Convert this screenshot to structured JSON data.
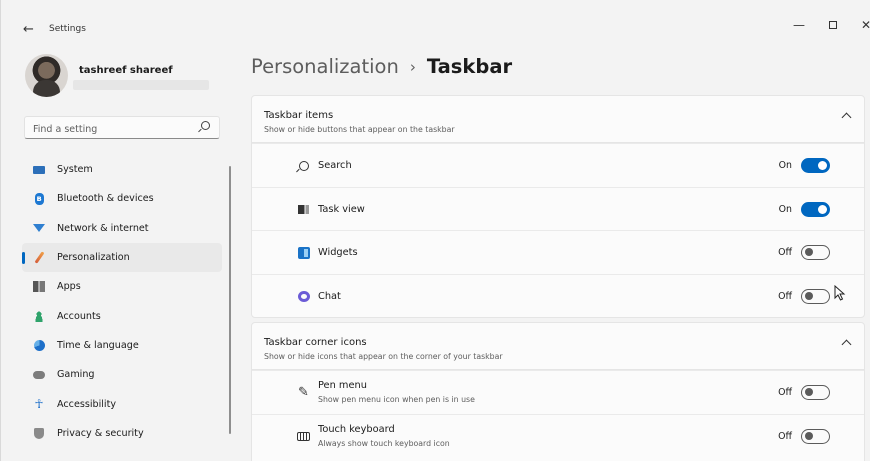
{
  "window": {
    "app_title": "Settings",
    "back_icon": "arrow-left-icon",
    "minimize_glyph": "—",
    "close_glyph": "✕"
  },
  "user": {
    "name": "tashreef shareef"
  },
  "search": {
    "placeholder": "Find a setting",
    "icon": "search-icon"
  },
  "sidebar": {
    "items": [
      {
        "label": "System",
        "icon": "monitor-icon"
      },
      {
        "label": "Bluetooth & devices",
        "icon": "bluetooth-icon"
      },
      {
        "label": "Network & internet",
        "icon": "wifi-icon"
      },
      {
        "label": "Personalization",
        "icon": "brush-icon",
        "active": true
      },
      {
        "label": "Apps",
        "icon": "apps-icon"
      },
      {
        "label": "Accounts",
        "icon": "person-icon"
      },
      {
        "label": "Time & language",
        "icon": "globe-clock-icon"
      },
      {
        "label": "Gaming",
        "icon": "gamepad-icon"
      },
      {
        "label": "Accessibility",
        "icon": "accessibility-icon"
      },
      {
        "label": "Privacy & security",
        "icon": "shield-icon"
      }
    ],
    "accent_color": "#0067c0"
  },
  "breadcrumb": {
    "parent": "Personalization",
    "separator": "›",
    "current": "Taskbar"
  },
  "sections": {
    "taskbar_items": {
      "title": "Taskbar items",
      "subtitle": "Show or hide buttons that appear on the taskbar",
      "rows": [
        {
          "label": "Search",
          "state": "On",
          "on": true,
          "icon": "search-icon"
        },
        {
          "label": "Task view",
          "state": "On",
          "on": true,
          "icon": "task-view-icon"
        },
        {
          "label": "Widgets",
          "state": "Off",
          "on": false,
          "icon": "widgets-icon"
        },
        {
          "label": "Chat",
          "state": "Off",
          "on": false,
          "icon": "chat-icon"
        }
      ]
    },
    "corner_icons": {
      "title": "Taskbar corner icons",
      "subtitle": "Show or hide icons that appear on the corner of your taskbar",
      "rows": [
        {
          "label": "Pen menu",
          "description": "Show pen menu icon when pen is in use",
          "state": "Off",
          "on": false,
          "icon": "pen-icon"
        },
        {
          "label": "Touch keyboard",
          "description": "Always show touch keyboard icon",
          "state": "Off",
          "on": false,
          "icon": "keyboard-icon"
        }
      ]
    }
  },
  "colors": {
    "toggle_on": "#0067c0",
    "background": "#f3f3f3",
    "card": "#fbfbfb"
  }
}
